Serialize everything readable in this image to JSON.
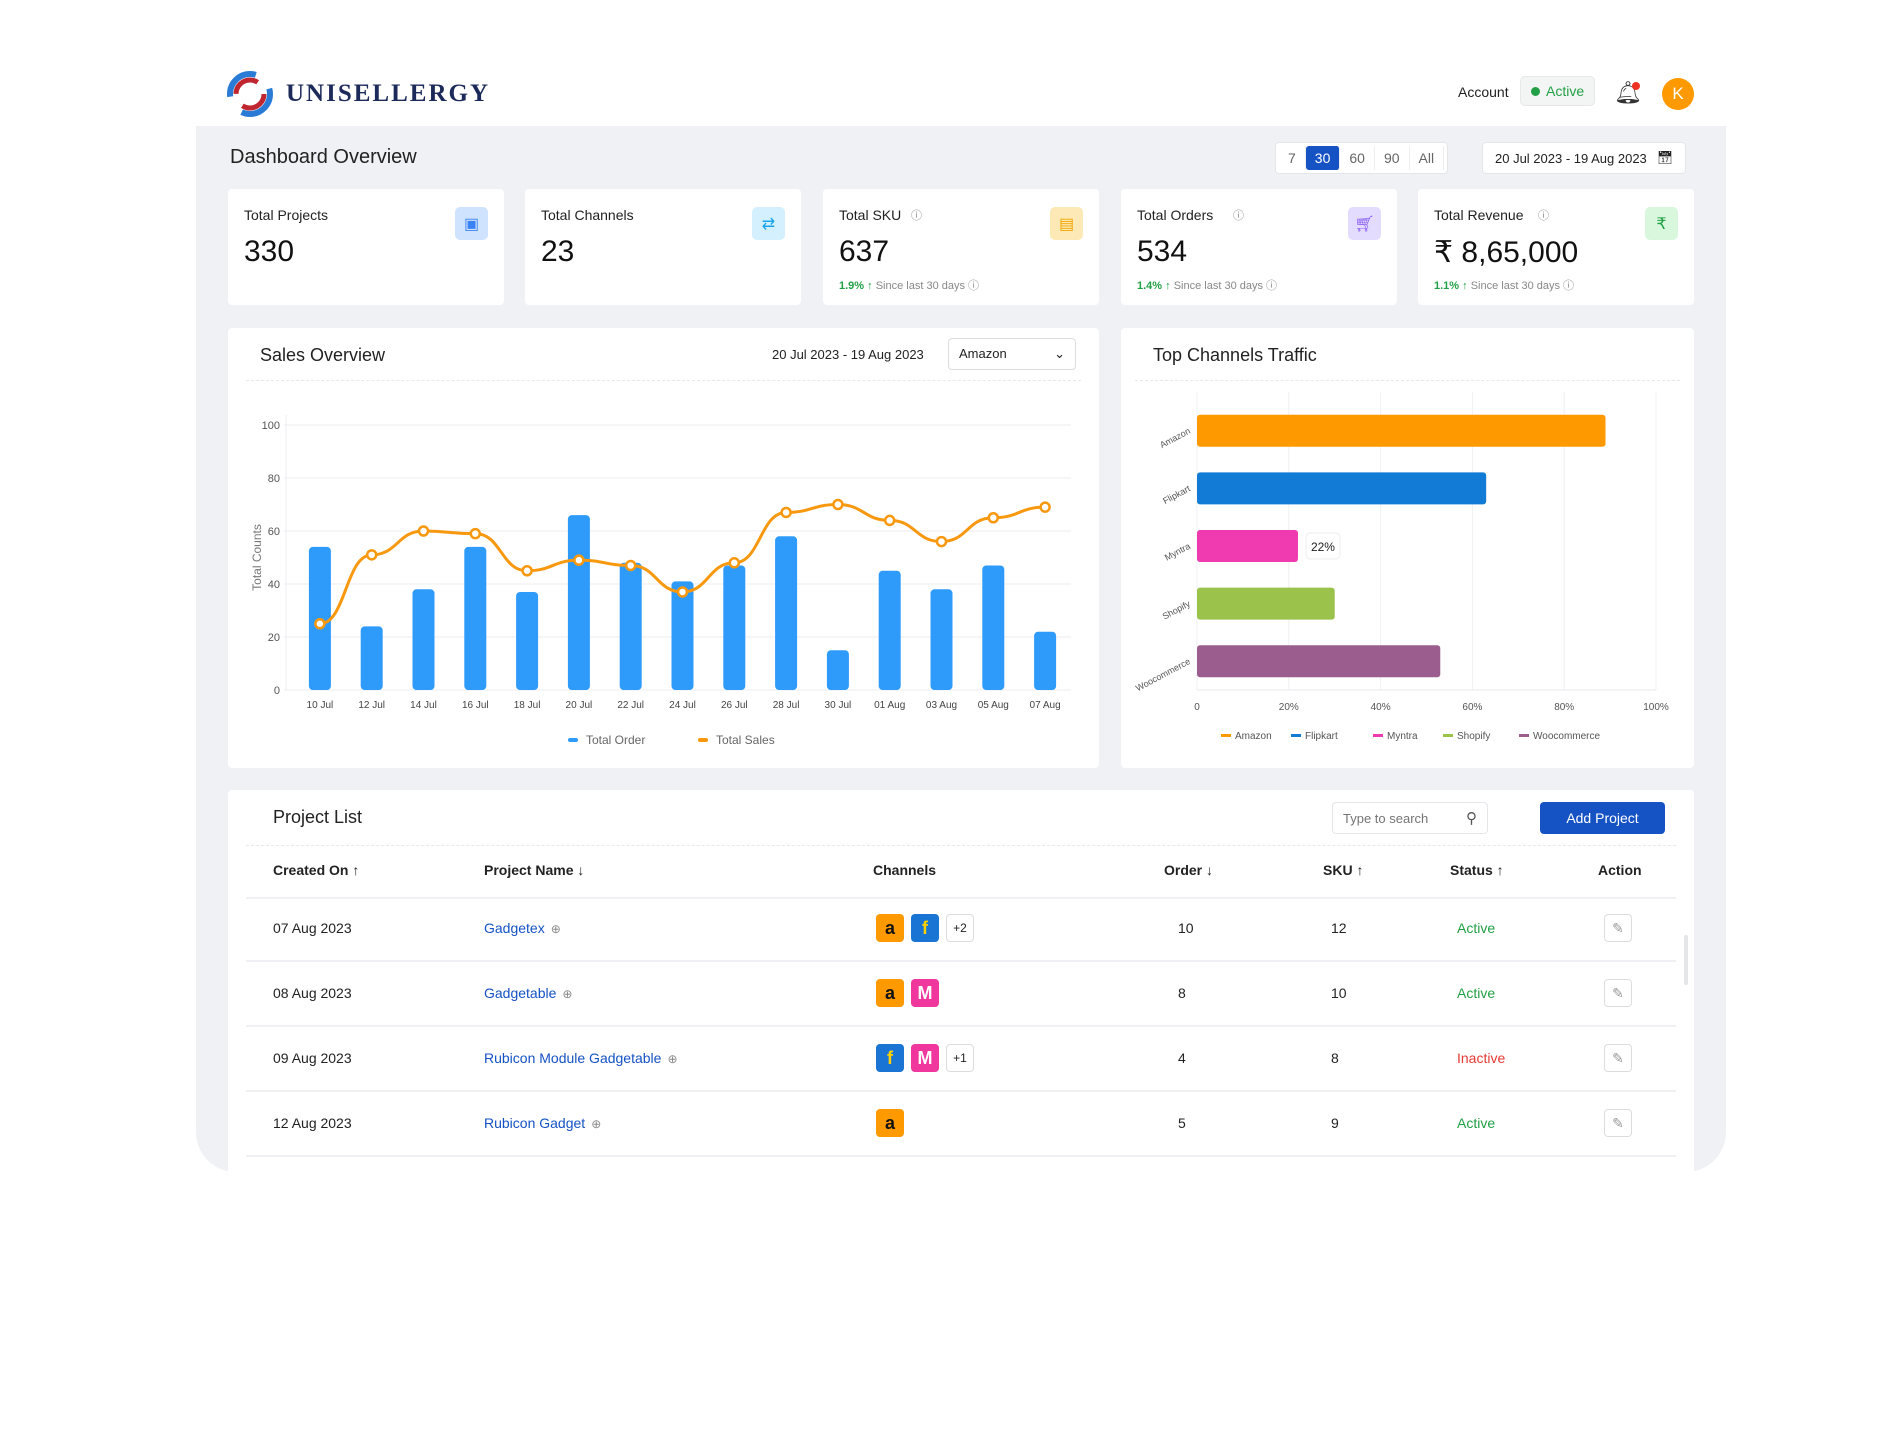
{
  "header": {
    "brand": "UNISELLERGY",
    "account_label": "Account",
    "account_status": "Active",
    "avatar_initial": "K"
  },
  "dashboard": {
    "title": "Dashboard Overview",
    "ranges": [
      "7",
      "30",
      "60",
      "90",
      "All"
    ],
    "selected_range": "30",
    "date_range": "20 Jul 2023 - 19 Aug 2023"
  },
  "cards": [
    {
      "label": "Total Projects",
      "value": "330",
      "icon": "monitor-icon",
      "icon_bg": "#cfe3ff",
      "icon_color": "#3b82f6"
    },
    {
      "label": "Total Channels",
      "value": "23",
      "icon": "channels-icon",
      "icon_bg": "#d4f0ff",
      "icon_color": "#1aa3e8"
    },
    {
      "label": "Total SKU",
      "value": "637",
      "icon": "box-icon",
      "icon_bg": "#fde9b5",
      "icon_color": "#f0a500",
      "trend": "1.9%",
      "since": "Since last 30 days"
    },
    {
      "label": "Total Orders",
      "value": "534",
      "icon": "cart-icon",
      "icon_bg": "#e4dcff",
      "icon_color": "#8a5cf5",
      "trend": "1.4%",
      "since": "Since last 30 days"
    },
    {
      "label": "Total Revenue",
      "value": "₹ 8,65,000",
      "icon": "rupee-icon",
      "icon_bg": "#d9f7dd",
      "icon_color": "#22a045",
      "trend": "1.1%",
      "since": "Since last 30 days"
    }
  ],
  "sales": {
    "title": "Sales Overview",
    "date_range": "20 Jul  2023 - 19 Aug 2023",
    "channel": "Amazon"
  },
  "traffic": {
    "title": "Top Channels Traffic"
  },
  "chart_data": [
    {
      "type": "bar+line",
      "ylabel": "Total Counts",
      "ylim": [
        0,
        100
      ],
      "yticks": [
        0,
        20,
        40,
        60,
        80,
        100
      ],
      "grid": true,
      "legend": "bottom",
      "categories": [
        "10 Jul",
        "12 Jul",
        "14 Jul",
        "16 Jul",
        "18 Jul",
        "20 Jul",
        "22 Jul",
        "24 Jul",
        "26 Jul",
        "28 Jul",
        "30 Jul",
        "01 Aug",
        "03 Aug",
        "05 Aug",
        "07 Aug"
      ],
      "series": [
        {
          "name": "Total Order",
          "type": "bar",
          "color": "#2e9bfb",
          "values": [
            54,
            24,
            38,
            54,
            37,
            66,
            48,
            41,
            47,
            58,
            15,
            45,
            38,
            47,
            22
          ]
        },
        {
          "name": "Total Sales",
          "type": "line",
          "color": "#f7980f",
          "values": [
            25,
            51,
            60,
            59,
            45,
            49,
            47,
            37,
            48,
            67,
            70,
            64,
            56,
            65,
            69
          ]
        }
      ]
    },
    {
      "type": "bar",
      "orientation": "horizontal",
      "xlim": [
        0,
        100
      ],
      "xticks": [
        "0",
        "20%",
        "40%",
        "60%",
        "80%",
        "100%"
      ],
      "grid": true,
      "legend": "bottom",
      "categories": [
        "Amazon",
        "Flipkart",
        "Myntra",
        "Shopify",
        "Woocommerce"
      ],
      "values": [
        89,
        63,
        22,
        30,
        53
      ],
      "colors": [
        "#ff9900",
        "#117bd6",
        "#f03bb0",
        "#9bc24a",
        "#9b5d8d"
      ],
      "tooltip": {
        "category": "Myntra",
        "text": "22%"
      }
    }
  ],
  "projects": {
    "title": "Project List",
    "search_placeholder": "Type to search",
    "add_label": "Add Project",
    "columns": [
      "Created On ↑",
      "Project Name ↓",
      "Channels",
      "Order ↓",
      "SKU ↑",
      "Status ↑",
      "Action"
    ],
    "rows": [
      {
        "created": "07 Aug 2023",
        "name": "Gadgetex",
        "channels": [
          "amazon",
          "flipkart"
        ],
        "more": "+2",
        "order": "10",
        "sku": "12",
        "status": "Active"
      },
      {
        "created": "08 Aug 2023",
        "name": "Gadgetable",
        "channels": [
          "amazon",
          "myntra"
        ],
        "more": "",
        "order": "8",
        "sku": "10",
        "status": "Active"
      },
      {
        "created": "09 Aug 2023",
        "name": "Rubicon Module Gadgetable",
        "channels": [
          "flipkart",
          "myntra"
        ],
        "more": "+1",
        "order": "4",
        "sku": "8",
        "status": "Inactive"
      },
      {
        "created": "12 Aug 2023",
        "name": "Rubicon Gadget",
        "channels": [
          "amazon"
        ],
        "more": "",
        "order": "5",
        "sku": "9",
        "status": "Active"
      }
    ]
  },
  "colors": {
    "primary": "#1552c4",
    "active": "#22a045",
    "inactive": "#e53935"
  }
}
